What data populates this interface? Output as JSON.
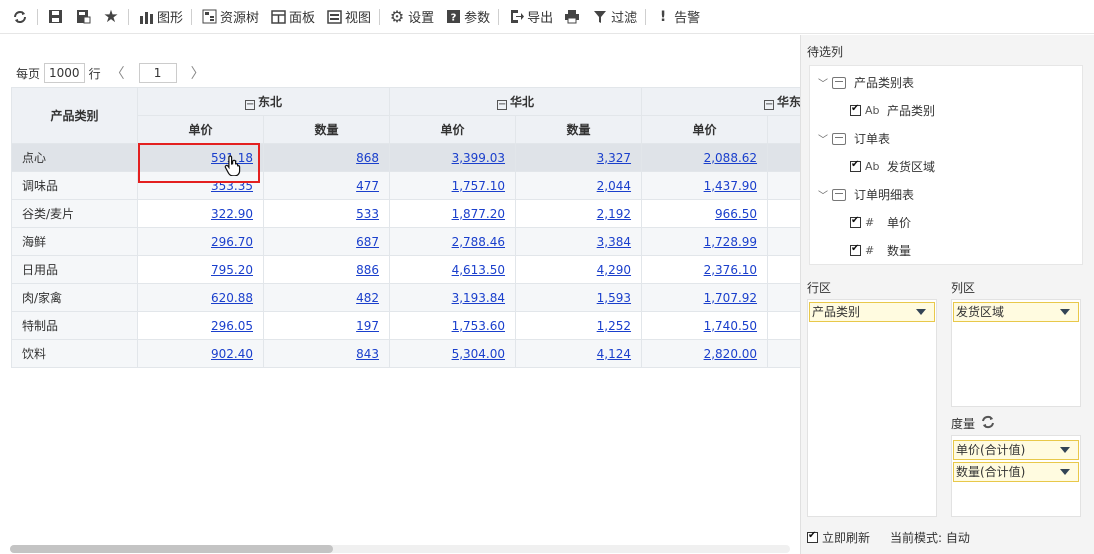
{
  "toolbar": {
    "items": [
      {
        "icon": "refresh-icon",
        "label": ""
      },
      {
        "icon": "save-icon",
        "label": ""
      },
      {
        "icon": "save-as-icon",
        "label": ""
      },
      {
        "icon": "star-icon",
        "label": ""
      },
      {
        "icon": "chart-icon",
        "label": "图形"
      },
      {
        "icon": "resource-tree-icon",
        "label": "资源树"
      },
      {
        "icon": "panel-icon",
        "label": "面板"
      },
      {
        "icon": "view-icon",
        "label": "视图"
      },
      {
        "icon": "gear-icon",
        "label": "设置"
      },
      {
        "icon": "params-icon",
        "label": "参数"
      },
      {
        "icon": "export-icon",
        "label": "导出"
      },
      {
        "icon": "print-icon",
        "label": ""
      },
      {
        "icon": "filter-icon",
        "label": "过滤"
      },
      {
        "icon": "alert-icon",
        "label": "告警"
      }
    ]
  },
  "pager": {
    "prefix": "每页",
    "page_size": "1000",
    "suffix": "行",
    "prev": "〈",
    "page": "1",
    "next": "〉"
  },
  "table": {
    "row_header": "产品类别",
    "regions": [
      "东北",
      "华北",
      "华东"
    ],
    "measures": [
      "单价",
      "数量",
      "单价",
      "数量",
      "单价"
    ],
    "rows": [
      {
        "name": "点心",
        "values": [
          "591.18",
          "868",
          "3,399.03",
          "3,327",
          "2,088.62"
        ]
      },
      {
        "name": "调味品",
        "values": [
          "353.35",
          "477",
          "1,757.10",
          "2,044",
          "1,437.90"
        ]
      },
      {
        "name": "谷类/麦片",
        "values": [
          "322.90",
          "533",
          "1,877.20",
          "2,192",
          "966.50"
        ]
      },
      {
        "name": "海鲜",
        "values": [
          "296.70",
          "687",
          "2,788.46",
          "3,384",
          "1,728.99"
        ]
      },
      {
        "name": "日用品",
        "values": [
          "795.20",
          "886",
          "4,613.50",
          "4,290",
          "2,376.10"
        ]
      },
      {
        "name": "肉/家禽",
        "values": [
          "620.88",
          "482",
          "3,193.84",
          "1,593",
          "1,707.92"
        ]
      },
      {
        "name": "特制品",
        "values": [
          "296.05",
          "197",
          "1,753.60",
          "1,252",
          "1,740.50"
        ]
      },
      {
        "name": "饮料",
        "values": [
          "902.40",
          "843",
          "5,304.00",
          "4,124",
          "2,820.00"
        ]
      }
    ]
  },
  "panel": {
    "title": "待选列",
    "tree": [
      {
        "table": "产品类别表",
        "fields": [
          {
            "type": "Ab",
            "name": "产品类别"
          }
        ]
      },
      {
        "table": "订单表",
        "fields": [
          {
            "type": "Ab",
            "name": "发货区域"
          }
        ]
      },
      {
        "table": "订单明细表",
        "fields": [
          {
            "type": "#",
            "name": "单价"
          },
          {
            "type": "#",
            "name": "数量"
          }
        ]
      }
    ],
    "row_zone_label": "行区",
    "col_zone_label": "列区",
    "measure_label": "度量",
    "row_chip": "产品类别",
    "col_chip": "发货区域",
    "measure_chips": [
      "单价(合计值)",
      "数量(合计值)"
    ],
    "auto_refresh_label": "立即刷新",
    "mode_label": "当前模式: 自动"
  }
}
